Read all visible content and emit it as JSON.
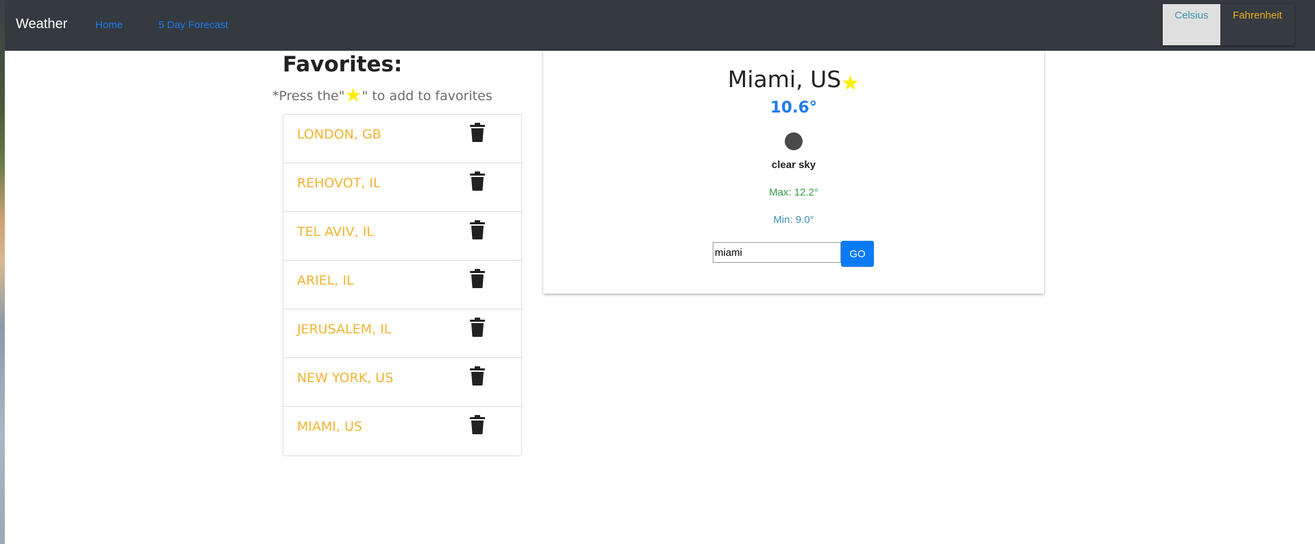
{
  "navbar": {
    "brand": "Weather",
    "links": [
      {
        "label": "Home"
      },
      {
        "label": "5 Day Forecast"
      }
    ],
    "units": {
      "celsius": "Celsius",
      "fahrenheit": "Fahrenheit",
      "selected": "Celsius"
    }
  },
  "favorites": {
    "title": "Favorites:",
    "hint_before": "*Press the\"",
    "hint_after": "\" to add to favorites",
    "items": [
      {
        "name": "LONDON, GB"
      },
      {
        "name": "REHOVOT, IL"
      },
      {
        "name": "TEL AVIV, IL"
      },
      {
        "name": "ARIEL, IL"
      },
      {
        "name": "JERUSALEM, IL"
      },
      {
        "name": "NEW YORK, US"
      },
      {
        "name": "MIAMI, US"
      }
    ]
  },
  "weather": {
    "city": "Miami, US",
    "temperature": "10.6°",
    "icon": "weather-condition-icon",
    "description": "clear sky",
    "max": "Max: 12.2°",
    "min": "Min: 9.0°",
    "search_value": "miami",
    "go_label": "GO"
  },
  "colors": {
    "navbar_bg": "#343a40",
    "link": "#1f7cf0",
    "favorite_text": "#f0b431",
    "star": "#ffee00",
    "max_text": "#2e9e44",
    "min_text": "#3a8fb5",
    "go_button": "#0a7bf5"
  }
}
